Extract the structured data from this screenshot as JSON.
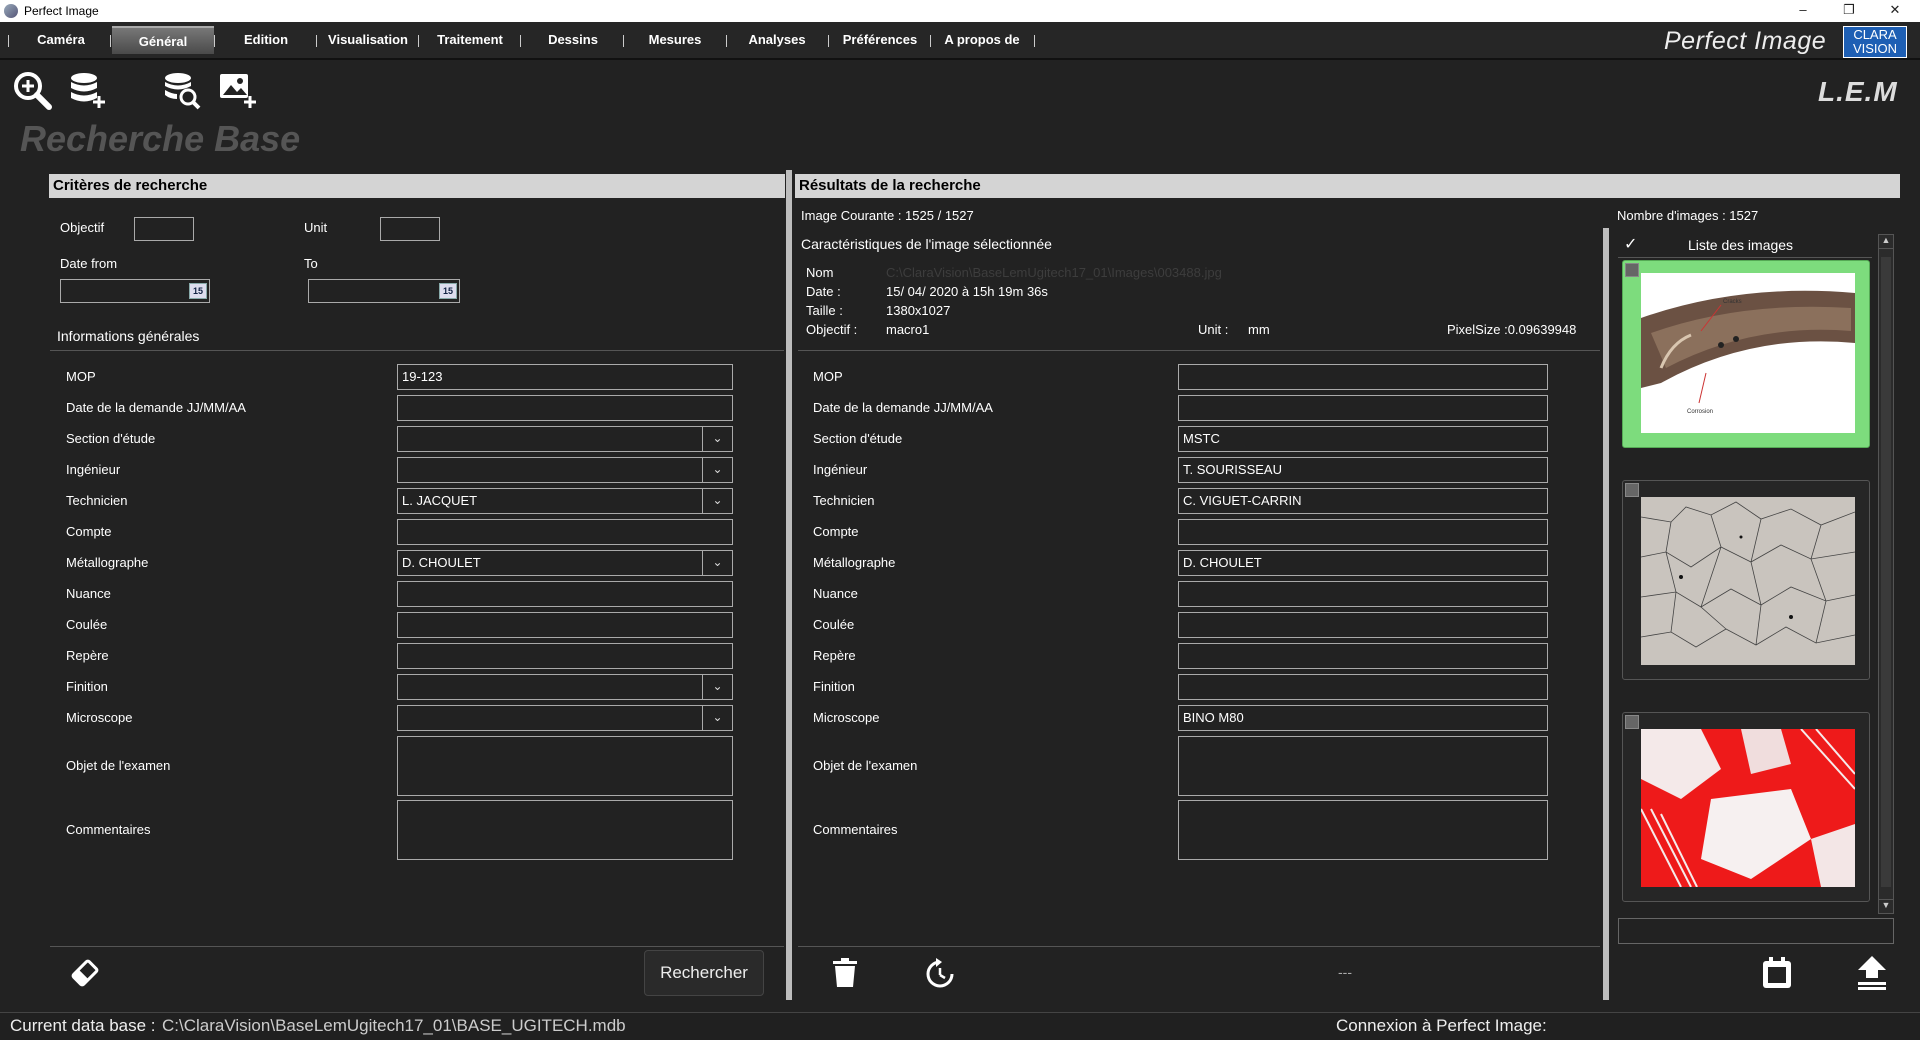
{
  "window": {
    "title": "Perfect Image"
  },
  "menu": {
    "items": [
      "Caméra",
      "Général",
      "Edition",
      "Visualisation",
      "Traitement",
      "Dessins",
      "Mesures",
      "Analyses",
      "Préférences",
      "A propos de"
    ],
    "active": "Général"
  },
  "brand": {
    "name": "Perfect Image",
    "logo_line1": "CLARA",
    "logo_line2": "VISION",
    "lab": "L.E.M"
  },
  "toolbar": {
    "icons": [
      "zoom-in-icon",
      "database-add-icon",
      "database-search-icon",
      "image-add-icon"
    ]
  },
  "page_title": "Recherche Base",
  "criteria": {
    "title": "Critères de recherche",
    "objectif_label": "Objectif",
    "objectif_value": "",
    "unit_label": "Unit",
    "unit_value": "",
    "date_from_label": "Date from",
    "date_to_label": "To",
    "date_from": "",
    "date_to": "",
    "calendar_glyph": "15",
    "section_title": "Informations générales",
    "fields": [
      {
        "label": "MOP",
        "value": "19-123",
        "type": "text"
      },
      {
        "label": "Date de la demande JJ/MM/AA",
        "value": "",
        "type": "text"
      },
      {
        "label": "Section d'étude",
        "value": "",
        "type": "combo"
      },
      {
        "label": "Ingénieur",
        "value": "",
        "type": "combo"
      },
      {
        "label": "Technicien",
        "value": "L. JACQUET",
        "type": "combo"
      },
      {
        "label": "Compte",
        "value": "",
        "type": "text"
      },
      {
        "label": "Métallographe",
        "value": "D. CHOULET",
        "type": "combo"
      },
      {
        "label": "Nuance",
        "value": "",
        "type": "text"
      },
      {
        "label": "Coulée",
        "value": "",
        "type": "text"
      },
      {
        "label": "Repère",
        "value": "",
        "type": "text"
      },
      {
        "label": "Finition",
        "value": "",
        "type": "combo"
      },
      {
        "label": "Microscope",
        "value": "",
        "type": "combo"
      },
      {
        "label": "Objet de l'examen",
        "value": "",
        "type": "area"
      },
      {
        "label": "Commentaires",
        "value": "",
        "type": "area"
      }
    ],
    "search_button": "Rechercher"
  },
  "results": {
    "title": "Résultats de la recherche",
    "current_image": "Image Courante : 1525 / 1527",
    "image_count": "Nombre d'images : 1527",
    "selected_title": "Caractéristiques de l'image sélectionnée",
    "nom_label": "Nom",
    "nom_value": "C:\\ClaraVision\\BaseLemUgitech17_01\\Images\\003488.jpg",
    "date_label": "Date :",
    "date_value": "15/ 04/ 2020  à  15h 19m 36s",
    "taille_label": "Taille :",
    "taille_value": "1380x1027",
    "objectif_label": "Objectif :",
    "objectif_value": "macro1",
    "unit_label": "Unit :",
    "unit_value": "mm",
    "pixelsize": "PixelSize :0.09639948",
    "fields": [
      {
        "label": "MOP",
        "value": ""
      },
      {
        "label": "Date de la demande JJ/MM/AA",
        "value": ""
      },
      {
        "label": "Section d'étude",
        "value": "MSTC"
      },
      {
        "label": "Ingénieur",
        "value": "T. SOURISSEAU"
      },
      {
        "label": "Technicien",
        "value": "C. VIGUET-CARRIN"
      },
      {
        "label": "Compte",
        "value": ""
      },
      {
        "label": "Métallographe",
        "value": "D. CHOULET"
      },
      {
        "label": "Nuance",
        "value": ""
      },
      {
        "label": "Coulée",
        "value": ""
      },
      {
        "label": "Repère",
        "value": ""
      },
      {
        "label": "Finition",
        "value": ""
      },
      {
        "label": "Microscope",
        "value": "BINO M80"
      },
      {
        "label": "Objet de l'examen",
        "value": ""
      },
      {
        "label": "Commentaires",
        "value": ""
      }
    ],
    "placeholder_dashes": "---",
    "list_header": "Liste des images",
    "thumb1_labels": [
      "Cracks",
      "Corrosion"
    ]
  },
  "status": {
    "db_label": "Current data base :",
    "db_path": "C:\\ClaraVision\\BaseLemUgitech17_01\\BASE_UGITECH.mdb",
    "connection": "Connexion à Perfect Image:"
  },
  "colors": {
    "selection": "#7ddc7d",
    "accent": "#1e5fb4",
    "background": "#222222",
    "panel_header": "#d4d4d4"
  }
}
